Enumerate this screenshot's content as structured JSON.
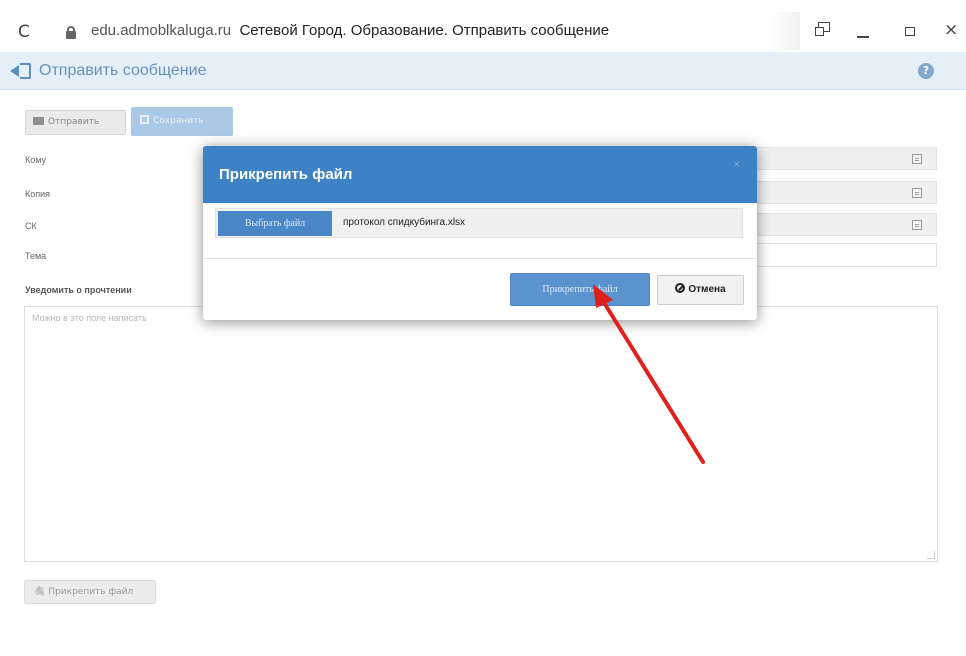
{
  "browser": {
    "domain": "edu.admoblkaluga.ru",
    "page_title": "Сетевой Город. Образование. Отправить сообщение"
  },
  "page": {
    "title": "Отправить сообщение",
    "help": "?"
  },
  "toolbar": {
    "send_label": "Отправить",
    "save_label": "Сохранить"
  },
  "form": {
    "to_label": "Кому",
    "cc_label": "Копия",
    "bcc_label": "СК",
    "subject_label": "Тема",
    "read_receipt_label": "Уведомить о прочтении",
    "message_placeholder": "Можно в это поле написать",
    "attach_button": "Прикрепить файл"
  },
  "dialog": {
    "title": "Прикрепить файл",
    "close": "×",
    "choose_file_button": "Выбрать файл",
    "file_name": "протокол спидкубинга.xlsx",
    "attach_button": "Прикрепить файл",
    "cancel_button": "Отмена"
  },
  "colors": {
    "dialog_header": "#3c82c4",
    "page_header_bg": "#e5eff8",
    "accent_arrow": "#e0201c"
  }
}
